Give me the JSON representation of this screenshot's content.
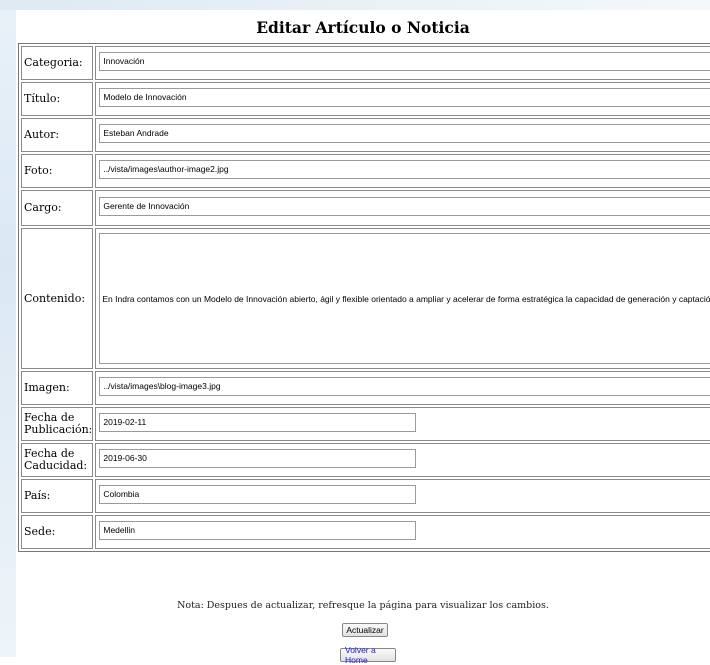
{
  "title": "Editar Artículo o Noticia",
  "fields": {
    "categoria": {
      "label": "Categoria:",
      "value": "Innovación"
    },
    "titulo": {
      "label": "Título:",
      "value": "Modelo de Innovación"
    },
    "autor": {
      "label": "Autor:",
      "value": "Esteban Andrade"
    },
    "foto": {
      "label": "Foto:",
      "value": "../vista/images\\author-image2.jpg"
    },
    "cargo": {
      "label": "Cargo:",
      "value": "Gerente de Innovación"
    },
    "contenido": {
      "label": "Contenido:",
      "value": "En Indra contamos con un Modelo de Innovación abierto, ágil y flexible orientado a ampliar y acelerar de forma estratégica la capacidad de generación y captación de ide"
    },
    "imagen": {
      "label": "Imagen:",
      "value": "../vista/images\\blog-image3.jpg"
    },
    "fecha_publicacion": {
      "label_line1": "Fecha de",
      "label_line2": "Publicación:",
      "value": "2019-02-11"
    },
    "fecha_caducidad": {
      "label_line1": "Fecha de",
      "label_line2": "Caducidad:",
      "value": "2019-06-30"
    },
    "pais": {
      "label": "País:",
      "value": "Colombia"
    },
    "sede": {
      "label": "Sede:",
      "value": "Medellin"
    }
  },
  "note": "Nota: Despues de actualizar, refresque la página para visualizar los cambios.",
  "buttons": {
    "update": "Actualizar",
    "home": "Volver a Home"
  }
}
